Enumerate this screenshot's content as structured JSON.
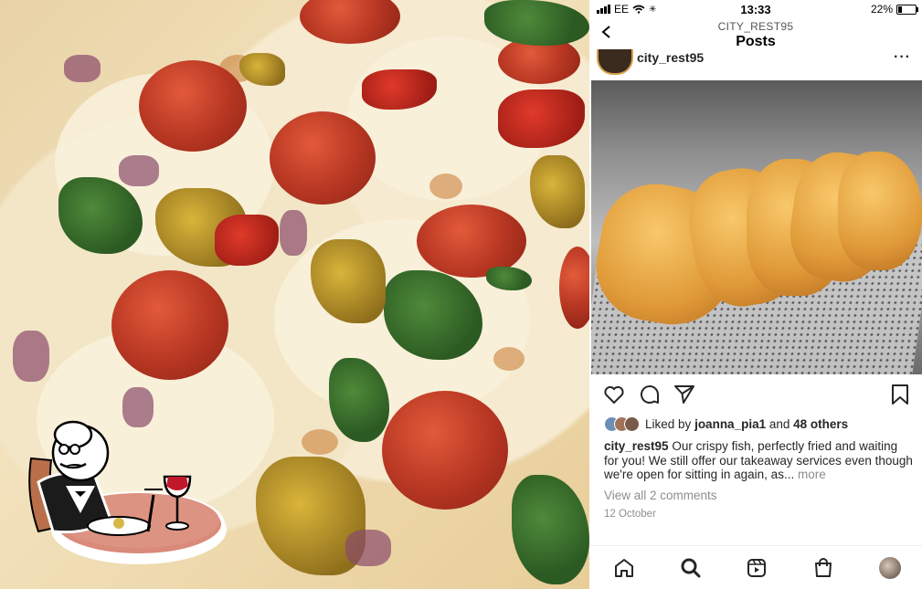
{
  "status_bar": {
    "carrier": "EE",
    "time": "13:33",
    "battery": "22%",
    "battery_level": 0.22
  },
  "header": {
    "username": "CITY_REST95",
    "title": "Posts"
  },
  "post": {
    "author": "city_rest95",
    "liked_by_prefix": "Liked by",
    "liked_by_user": "joanna_pia1",
    "liked_by_and": "and",
    "liked_by_others": "48 others",
    "caption_author": "city_rest95",
    "caption_text": "Our crispy fish, perfectly fried and waiting for you! We still offer our takeaway services even though we're open for sitting in again, as...",
    "caption_more": "more",
    "view_comments": "View all 2 comments",
    "date": "12 October"
  },
  "icons": {
    "actions": [
      "heart-icon",
      "comment-icon",
      "share-icon",
      "bookmark-icon"
    ],
    "tabs": [
      "home-icon",
      "search-icon",
      "reels-icon",
      "shop-icon",
      "profile-icon"
    ]
  }
}
